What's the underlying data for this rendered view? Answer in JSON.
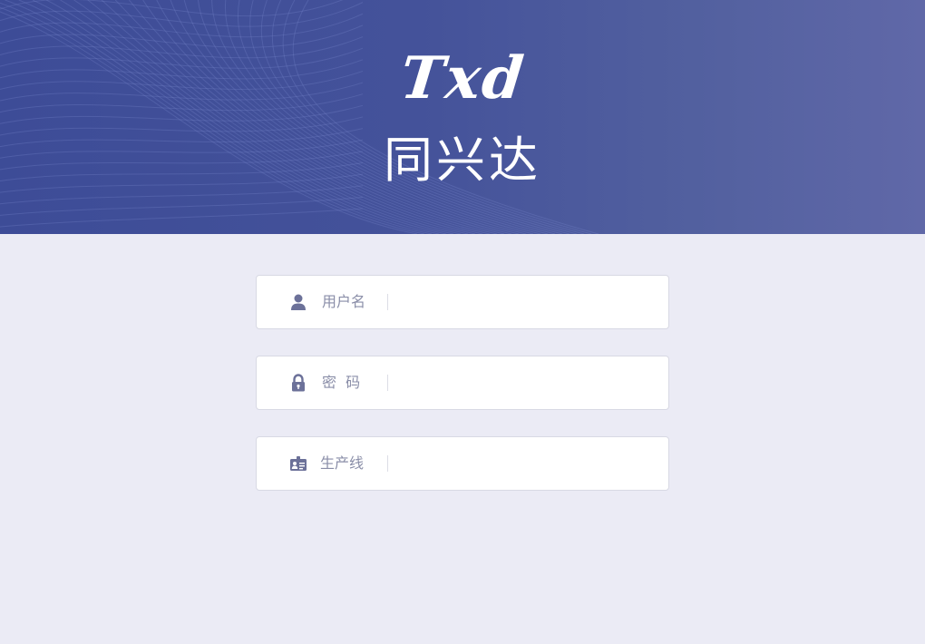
{
  "brand": {
    "logo_text": "Txd",
    "name": "同兴达"
  },
  "colors": {
    "banner": "#3d4c97",
    "background": "#ebebf5",
    "icon": "#6c7199",
    "label": "#8a8ea8"
  },
  "form": {
    "username": {
      "label": "用户名",
      "icon": "user-icon",
      "value": ""
    },
    "password": {
      "label": "密  码",
      "icon": "lock-icon",
      "value": ""
    },
    "production_line": {
      "label": "生产线",
      "icon": "id-card-icon",
      "value": ""
    }
  }
}
